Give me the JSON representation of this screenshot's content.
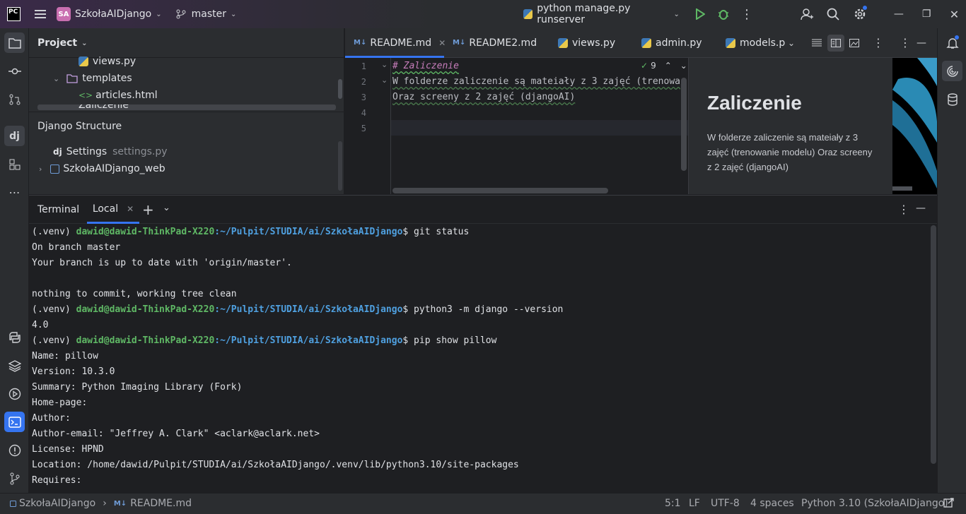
{
  "titlebar": {
    "logo": "PC",
    "project_badge": "SA",
    "project_name": "SzkołaAIDjango",
    "branch": "master",
    "run_config": "python manage.py runserver"
  },
  "project_panel": {
    "title": "Project",
    "tree": [
      {
        "label": "views.py",
        "icon": "python-file-icon"
      },
      {
        "label": "templates",
        "icon": "folder-icon"
      },
      {
        "label": "articles.html",
        "icon": "html-file-icon"
      },
      {
        "label": "Zaliczenie",
        "icon": "folder-icon"
      }
    ]
  },
  "django_structure": {
    "title": "Django Structure",
    "settings_label": "Settings",
    "settings_file": "settings.py",
    "web_item": "SzkołaAIDjango_web"
  },
  "editor": {
    "tabs": [
      {
        "label": "README.md",
        "icon": "markdown-icon",
        "active": true
      },
      {
        "label": "README2.md",
        "icon": "markdown-icon"
      },
      {
        "label": "views.py",
        "icon": "python-file-icon"
      },
      {
        "label": "admin.py",
        "icon": "python-file-icon"
      },
      {
        "label": "models.p",
        "icon": "python-file-icon"
      }
    ],
    "md_badge": "M↓",
    "inspection_count": "9",
    "line_numbers": [
      "1",
      "2",
      "3",
      "4",
      "5"
    ],
    "lines": [
      "# Zaliczenie",
      "W folderze zaliczenie są mateiały z 3 zajęć (trenowa",
      "Oraz screeny z 2 zajęć (djangoAI)",
      "",
      ""
    ],
    "preview": {
      "heading": "Zaliczenie",
      "body": "W folderze zaliczenie są mateiały z 3 zajęć (trenowanie modelu) Oraz screeny z 2 zajęć (djangoAI)"
    }
  },
  "terminal": {
    "title": "Terminal",
    "tab": "Local",
    "prompt_env": "(.venv) ",
    "prompt_user": "dawid@dawid-ThinkPad-X220",
    "prompt_path": ":~/Pulpit/STUDIA/ai/SzkołaAIDjango",
    "cmd1": "$ git status",
    "out1": "On branch master",
    "out2": "Your branch is up to date with 'origin/master'.",
    "out3": "nothing to commit, working tree clean",
    "cmd2": "$ python3 -m django --version",
    "out4": "4.0",
    "cmd3": "$ pip show pillow",
    "out5": "Name: pillow",
    "out6": "Version: 10.3.0",
    "out7": "Summary: Python Imaging Library (Fork)",
    "out8": "Home-page:",
    "out9": "Author:",
    "out10": "Author-email: \"Jeffrey A. Clark\" <aclark@aclark.net>",
    "out11": "License: HPND",
    "out12": "Location: /home/dawid/Pulpit/STUDIA/ai/SzkołaAIDjango/.venv/lib/python3.10/site-packages",
    "out13": "Requires:"
  },
  "statusbar": {
    "breadcrumb_project": "SzkołaAIDjango",
    "breadcrumb_file": "README.md",
    "position": "5:1",
    "line_sep": "LF",
    "encoding": "UTF-8",
    "indent": "4 spaces",
    "interpreter": "Python 3.10 (SzkołaAIDjango)"
  },
  "colors": {
    "accent": "#3574f0",
    "prompt_green": "#5fb865",
    "prompt_blue": "#4fa0e0",
    "heading_pink": "#c77dbb"
  }
}
